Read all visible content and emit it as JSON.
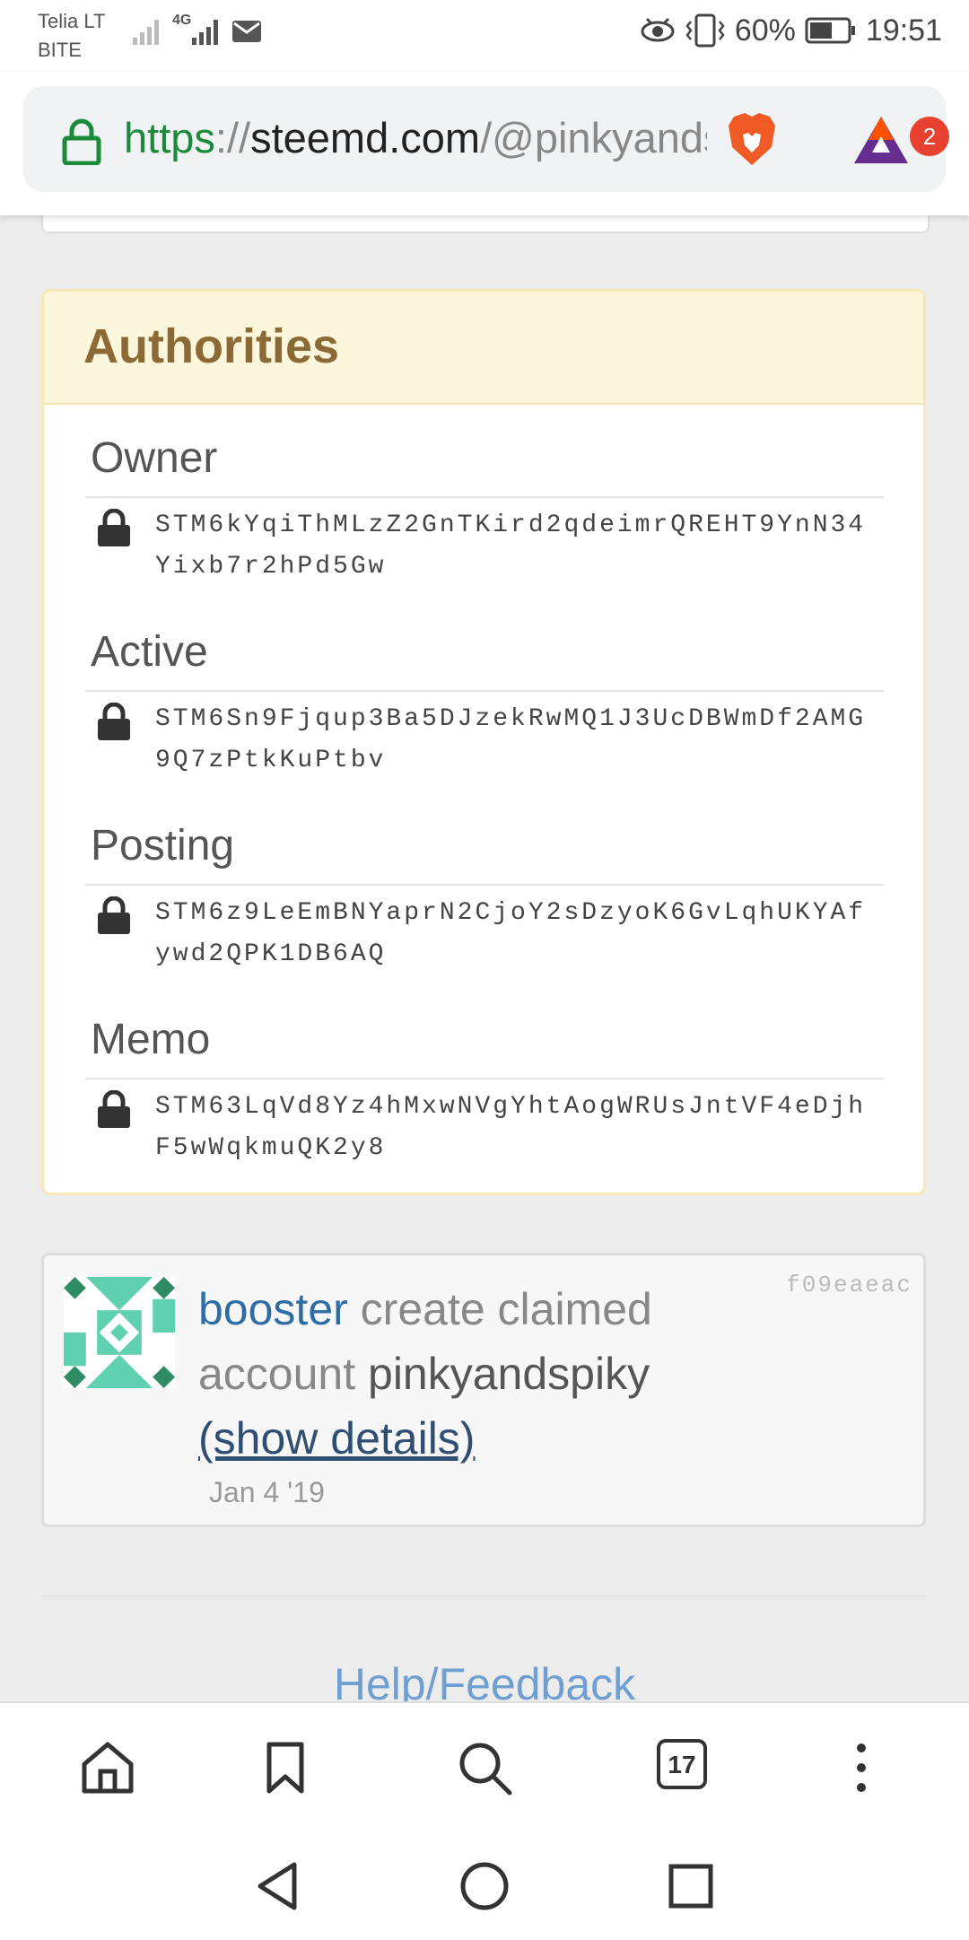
{
  "status_bar": {
    "carrier_line1": "Telia LT",
    "carrier_line2": "BITE",
    "network": "4G",
    "battery": "60%",
    "time": "19:51"
  },
  "browser": {
    "url_scheme": "https",
    "url_sep": "://",
    "url_host": "steemd.com",
    "url_path": "/@pinkyandspiky",
    "rewards_badge": "2"
  },
  "authorities": {
    "title": "Authorities",
    "items": [
      {
        "label": "Owner",
        "key": "STM6kYqiThMLzZ2GnTKird2qdeimrQREHT9YnN34Yixb7r2hPd5Gw"
      },
      {
        "label": "Active",
        "key": "STM6Sn9Fjqup3Ba5DJzekRwMQ1J3UcDBWmDf2AMG9Q7zPtkKuPtbv"
      },
      {
        "label": "Posting",
        "key": "STM6z9LeEmBNYaprN2CjoY2sDzyoK6GvLqhUKYAfywd2QPK1DB6AQ"
      },
      {
        "label": "Memo",
        "key": "STM63LqVd8Yz4hMxwNVgYhtAogWRUsJntVF4eDjhF5wWqkmuQK2y8"
      }
    ]
  },
  "activity": {
    "hash": "f09eaeac",
    "actor": "booster",
    "action": " create claimed account ",
    "target": "pinkyandspiky",
    "details_link": "(show details)",
    "date": "Jan 4 '19"
  },
  "footer": {
    "help_link": "Help/Feedback"
  },
  "toolbar": {
    "tab_count": "17"
  }
}
